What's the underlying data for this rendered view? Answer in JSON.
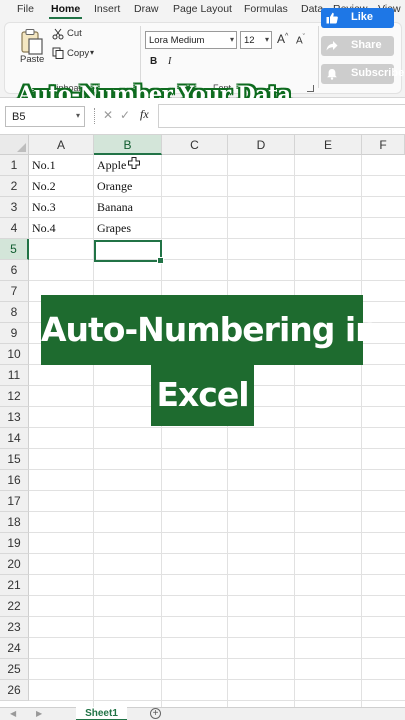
{
  "menu": {
    "tabs": [
      "File",
      "Home",
      "Insert",
      "Draw",
      "Page Layout",
      "Formulas",
      "Data",
      "Review",
      "View"
    ],
    "active_tab": "Home"
  },
  "ribbon": {
    "clipboard": {
      "paste_label": "Paste",
      "cut_label": "Cut",
      "copy_label": "Copy",
      "group_label": "Clipboard"
    },
    "font": {
      "font_name": "Lora Medium",
      "font_size": "12",
      "grow_label": "A",
      "shrink_label": "A",
      "bold_label": "B",
      "italic_label": "I",
      "group_label": "Font"
    }
  },
  "banner_title": "Auto-Number Your Data",
  "social": {
    "like": "Like",
    "share": "Share",
    "subscribe": "Subscribe",
    "like_color": "#1e77e6"
  },
  "formula_bar": {
    "name_box": "B5",
    "cancel_icon": "✕",
    "enter_icon": "✓",
    "fx_label": "fx",
    "formula": ""
  },
  "grid": {
    "columns": [
      "A",
      "B",
      "C",
      "D",
      "E",
      "F"
    ],
    "selected_column": "B",
    "rows": [
      "1",
      "2",
      "3",
      "4",
      "5",
      "6",
      "7",
      "8",
      "9",
      "10",
      "11",
      "12",
      "13",
      "14",
      "15",
      "16",
      "17",
      "18",
      "19",
      "20",
      "21",
      "22",
      "23",
      "24",
      "25",
      "26"
    ],
    "selected_row": "5",
    "col_a": [
      "No.1",
      "No.2",
      "No.3",
      "No.4"
    ],
    "col_b": [
      "Apple",
      "Orange",
      "Banana",
      "Grapes"
    ]
  },
  "overlay": {
    "line1": "Auto-Numbering in",
    "line2": "Excel",
    "bg_color": "#1e6b2f"
  },
  "sheets": {
    "tabs": [
      "Sheet1"
    ],
    "add_icon": "+"
  },
  "accent_color": "#217346"
}
